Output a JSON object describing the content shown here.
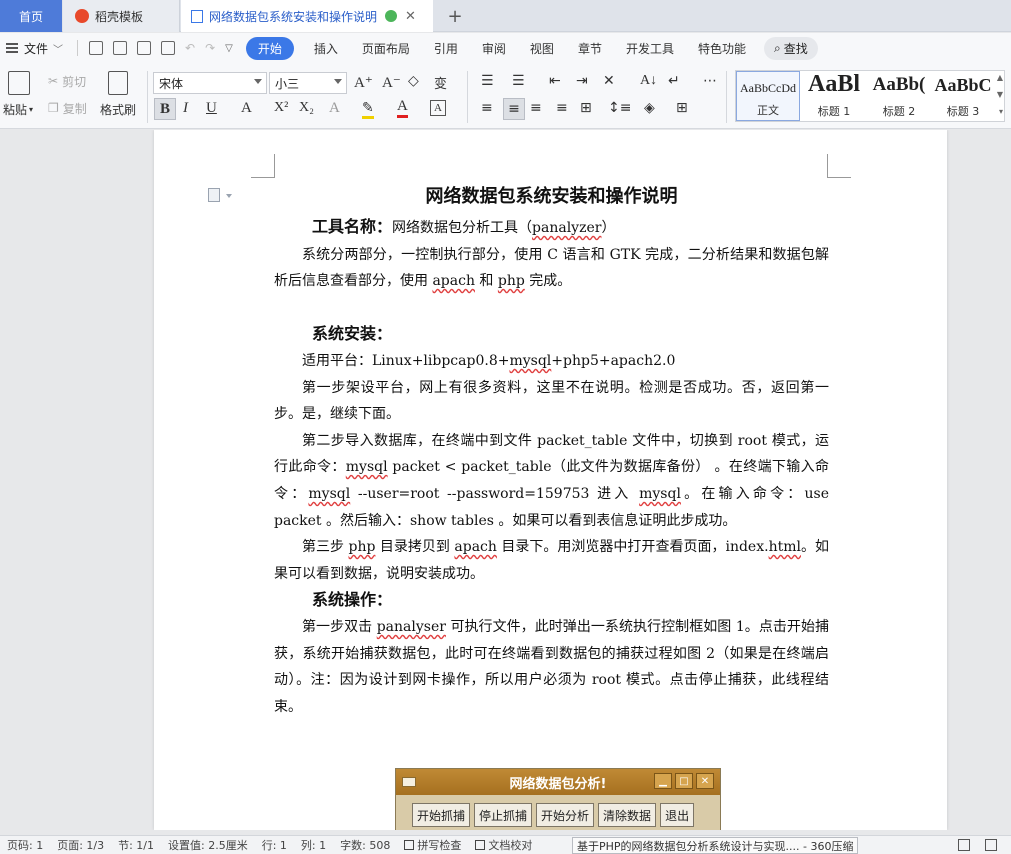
{
  "tabs": {
    "home": "首页",
    "template": "稻壳模板",
    "document": "网络数据包系统安装和操作说明",
    "add": "+"
  },
  "menu": {
    "file": "文件",
    "items": [
      "开始",
      "插入",
      "页面布局",
      "引用",
      "审阅",
      "视图",
      "章节",
      "开发工具",
      "特色功能"
    ],
    "search": "查找"
  },
  "ribbon": {
    "paste": "粘贴",
    "cut": "剪切",
    "copy": "复制",
    "format_painter": "格式刷",
    "font_name": "宋体",
    "font_size": "小三",
    "styles": [
      {
        "preview": "AaBbCcDd",
        "label": "正文"
      },
      {
        "preview": "AaBl",
        "label": "标题 1"
      },
      {
        "preview": "AaBb(",
        "label": "标题 2"
      },
      {
        "preview": "AaBbC",
        "label": "标题 3"
      }
    ]
  },
  "document": {
    "title": "网络数据包系统安装和操作说明",
    "tool_label": "工具名称：",
    "tool_name": "网络数据包分析工具（",
    "tool_name_code": "panalyzer",
    "tool_name_end": "）",
    "p1a": "系统分两部分，一控制执行部分，使用 C 语言和 GTK 完成，二分析结果和数据包解析后信息查看部分，使用 ",
    "p1_apach": "apach",
    "p1b": " 和 ",
    "p1_php": "php",
    "p1c": " 完成。",
    "h_install": "系统安装：",
    "platform_a": "适用平台：Linux+libpcap0.8+",
    "platform_mysql": "mysql",
    "platform_b": "+php5+apach2.0",
    "step1": "第一步架设平台，网上有很多资料，这里不在说明。检测是否成功。否，返回第一步。是，继续下面。",
    "step2a": "第二步导入数据库，在终端中到文件 packet_table 文件中，切换到 root 模式，运行此命令：",
    "step2_mysql1": "mysql",
    "step2b": " packet < packet_table（此文件为数据库备份） 。在终端下输入命令：",
    "step2_mysql2": "mysql",
    "step2c": " --user=root --password=159753 进入 ",
    "step2_mysql3": "mysql",
    "step2d": "。在输入命令：use packet 。然后输入：show tables 。如果可以看到表信息证明此步成功。",
    "step3a": "第三步 ",
    "step3_php": "php",
    "step3b": " 目录拷贝到 ",
    "step3_apach": "apach",
    "step3c": " 目录下。用浏览器中打开查看页面，index.",
    "step3_html": "html",
    "step3d": "。如果可以看到数据，说明安装成功。",
    "h_operate": "系统操作：",
    "op1a": "第一步双击 ",
    "op1_panalyser": "panalyser",
    "op1b": " 可执行文件，此时弹出一系统执行控制框如图 1。点击开始捕获，系统开始捕获数据包，此时可在终端看到数据包的捕获过程如图 2（如果是在终端启动）。注：因为设计到网卡操作，所以用户必须为 root 模式。点击停止捕获，此线程结束。"
  },
  "app_window": {
    "title": "网络数据包分析!",
    "buttons": [
      "开始抓捕",
      "停止抓捕",
      "开始分析",
      "清除数据",
      "退出"
    ]
  },
  "status": {
    "page_code": "页码: 1",
    "pages": "页面: 1/3",
    "section": "节: 1/1",
    "setting": "设置值: 2.5厘米",
    "row": "行: 1",
    "col": "列: 1",
    "words": "字数: 508",
    "spell": "拼写检查",
    "proof": "文档校对",
    "tooltip": "基于PHP的网络数据包分析系统设计与实现.... - 360压缩"
  }
}
